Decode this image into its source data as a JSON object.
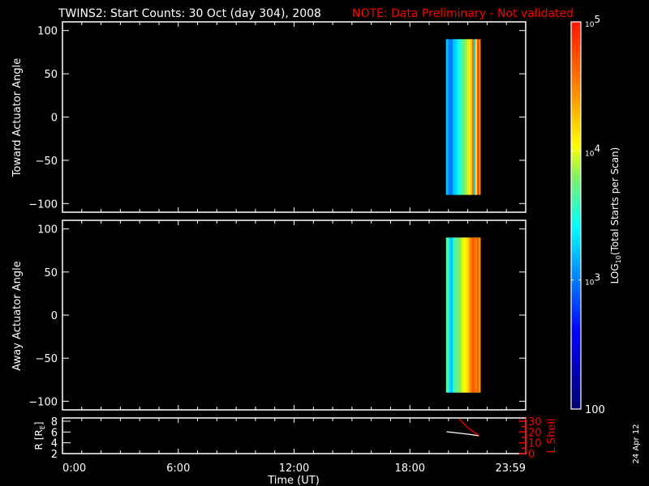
{
  "title": "TWINS2: Start Counts: 30 Oct (day 304), 2008",
  "note": "NOTE: Data Preliminary - Not validated",
  "date_stamp": "24 Apr 12",
  "colors": {
    "note": "#ff0000",
    "lshell": "#ff0000",
    "r_line": "#ffffff",
    "axes": "#ffffff",
    "background": "#000000"
  },
  "chart_data": [
    {
      "type": "heatmap",
      "name": "toward",
      "ylabel": "Toward Actuator Angle",
      "ylim": [
        -110,
        110
      ],
      "yticks": [
        100,
        50,
        0,
        -50,
        -100
      ],
      "xlim_hours": [
        0,
        24
      ],
      "data_angle_range": [
        -90,
        90
      ],
      "column_start_hours": [
        19.87,
        19.955,
        20.04,
        20.125,
        20.21,
        20.295,
        20.38,
        20.465,
        20.55,
        20.635,
        20.72,
        20.805,
        20.89,
        20.975,
        21.06,
        21.145,
        21.23,
        21.315,
        21.4,
        21.485,
        21.57
      ],
      "column_width_hours": 0.085,
      "log10_counts": [
        3.25,
        3.1,
        2.95,
        3.0,
        3.2,
        3.25,
        3.3,
        3.4,
        3.5,
        3.6,
        3.7,
        3.75,
        3.85,
        3.95,
        4.1,
        4.25,
        4.6,
        3.3,
        4.1,
        4.85,
        4.5
      ]
    },
    {
      "type": "heatmap",
      "name": "away",
      "ylabel": "Away Actuator Angle",
      "ylim": [
        -110,
        110
      ],
      "yticks": [
        100,
        50,
        0,
        -50,
        -100
      ],
      "xlim_hours": [
        0,
        24
      ],
      "data_angle_range": [
        -90,
        90
      ],
      "column_start_hours": [
        19.87,
        19.955,
        20.04,
        20.125,
        20.21,
        20.295,
        20.38,
        20.465,
        20.55,
        20.635,
        20.72,
        20.805,
        20.89,
        20.975,
        21.06,
        21.145,
        21.23,
        21.315,
        21.4,
        21.485,
        21.57
      ],
      "column_width_hours": 0.085,
      "log10_counts": [
        3.7,
        3.55,
        3.3,
        3.2,
        3.45,
        3.65,
        3.7,
        3.75,
        3.8,
        3.9,
        4.0,
        4.05,
        4.1,
        4.2,
        4.4,
        4.55,
        4.7,
        4.6,
        4.5,
        4.7,
        4.4
      ]
    },
    {
      "type": "line",
      "name": "orbit",
      "ylabel": "R [RE]",
      "ylabel_main": "R [R",
      "ylabel_sub": "E",
      "ylabel_end": "]",
      "ylim": [
        2,
        8
      ],
      "yticks": [
        8,
        6,
        4,
        2
      ],
      "y2label": "L Shell",
      "y2lim": [
        0,
        30
      ],
      "y2ticks": [
        30,
        20,
        10,
        0
      ],
      "xlabel": "Time (UT)",
      "xticks": [
        {
          "hour": 0,
          "label": "0:00"
        },
        {
          "hour": 6,
          "label": "6:00"
        },
        {
          "hour": 12,
          "label": "12:00"
        },
        {
          "hour": 18,
          "label": "18:00"
        },
        {
          "hour": 24,
          "label": "23:59"
        }
      ],
      "series": [
        {
          "name": "R",
          "axis": "left",
          "x_hours": [
            19.9,
            20.5,
            21.0,
            21.6
          ],
          "y": [
            6.05,
            5.8,
            5.6,
            5.3
          ]
        },
        {
          "name": "L Shell",
          "axis": "right",
          "x_hours": [
            20.55,
            21.0,
            21.6
          ],
          "y": [
            32,
            24,
            16.5
          ]
        }
      ]
    }
  ],
  "colorbar": {
    "label_main": "LOG",
    "label_sub": "10",
    "label_rest": "(Total Starts per Scan)",
    "log_range": [
      2,
      5
    ],
    "ticks": [
      {
        "log": 5,
        "base": "10",
        "exp": "5"
      },
      {
        "log": 4,
        "base": "10",
        "exp": "4"
      },
      {
        "log": 3,
        "base": "10",
        "exp": "3"
      },
      {
        "log": 2,
        "base": "100",
        "exp": ""
      }
    ]
  }
}
